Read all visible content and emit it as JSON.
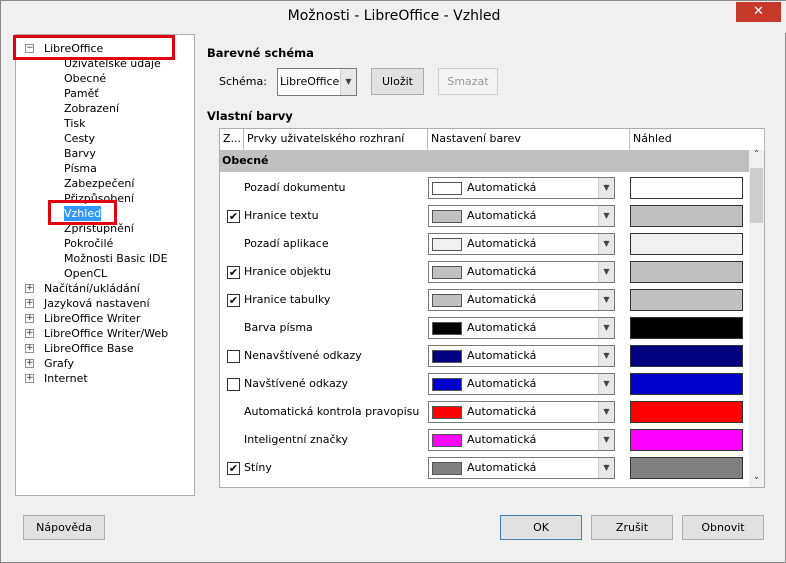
{
  "window": {
    "title": "Možnosti - LibreOffice - Vzhled",
    "close": "✕"
  },
  "tree": {
    "root": "LibreOffice",
    "children": [
      "Uživatelské údaje",
      "Obecné",
      "Paměť",
      "Zobrazení",
      "Tisk",
      "Cesty",
      "Barvy",
      "Písma",
      "Zabezpečení",
      "Přizpůsobení",
      "Vzhled",
      "Zpřístupnění",
      "Pokročilé",
      "Možnosti Basic IDE",
      "OpenCL"
    ],
    "selected": "Vzhled",
    "others": [
      "Načítání/ukládání",
      "Jazyková nastavení",
      "LibreOffice Writer",
      "LibreOffice Writer/Web",
      "LibreOffice Base",
      "Grafy",
      "Internet"
    ]
  },
  "scheme": {
    "heading": "Barevné schéma",
    "label": "Schéma:",
    "value": "LibreOffice",
    "save": "Uložit",
    "delete": "Smazat"
  },
  "custom": {
    "heading": "Vlastní barvy",
    "columns": [
      "Z...",
      "Prvky uživatelského rozhraní",
      "Nastavení barev",
      "Náhled"
    ],
    "group": "Obecné",
    "rows": [
      {
        "label": "Pozadí dokumentu",
        "checkbox": null,
        "value": "Automatická",
        "color": "#ffffff"
      },
      {
        "label": "Hranice textu",
        "checkbox": true,
        "value": "Automatická",
        "color": "#c0c0c0"
      },
      {
        "label": "Pozadí aplikace",
        "checkbox": null,
        "value": "Automatická",
        "color": "#f0f0f0"
      },
      {
        "label": "Hranice objektu",
        "checkbox": true,
        "value": "Automatická",
        "color": "#c0c0c0"
      },
      {
        "label": "Hranice tabulky",
        "checkbox": true,
        "value": "Automatická",
        "color": "#c0c0c0"
      },
      {
        "label": "Barva písma",
        "checkbox": null,
        "value": "Automatická",
        "color": "#000000"
      },
      {
        "label": "Nenavštívené odkazy",
        "checkbox": false,
        "value": "Automatická",
        "color": "#000080"
      },
      {
        "label": "Navštívené odkazy",
        "checkbox": false,
        "value": "Automatická",
        "color": "#0000cc"
      },
      {
        "label": "Automatická kontrola pravopisu",
        "checkbox": null,
        "value": "Automatická",
        "color": "#ff0000"
      },
      {
        "label": "Inteligentní značky",
        "checkbox": null,
        "value": "Automatická",
        "color": "#ff00ff"
      },
      {
        "label": "Stíny",
        "checkbox": true,
        "value": "Automatická",
        "color": "#808080"
      }
    ]
  },
  "buttons": {
    "help": "Nápověda",
    "ok": "OK",
    "cancel": "Zrušit",
    "reset": "Obnovit"
  }
}
